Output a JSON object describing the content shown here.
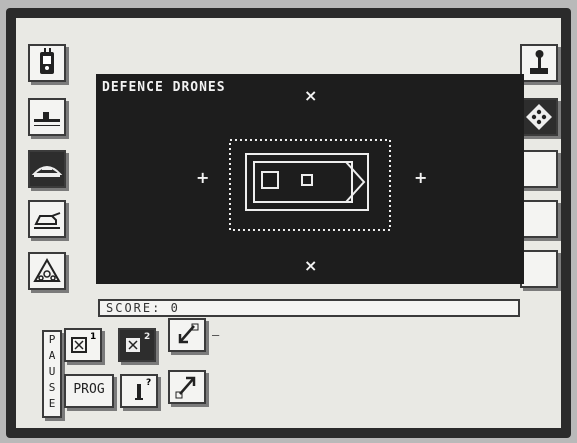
{
  "game": {
    "view_title": "DEFENCE DRONES",
    "score_label": "SCORE:",
    "score_value": "0"
  },
  "controls": {
    "pause_letters": [
      "P",
      "A",
      "U",
      "S",
      "E"
    ],
    "prog_label": "PROG",
    "drone1_number": "1",
    "drone2_number": "2",
    "info_number": "?"
  },
  "left_toolbar": [
    "drone-icon",
    "ship-icon",
    "hovercraft-icon",
    "tank-icon",
    "triangle-icon"
  ],
  "right_toolbar": [
    "joystick-icon",
    "dice-icon",
    "blank",
    "blank",
    "blank"
  ],
  "colors": {
    "screen_bg": "#1d1d1d",
    "panel_bg": "#e9e9e4",
    "ink": "#2d2d2d"
  }
}
